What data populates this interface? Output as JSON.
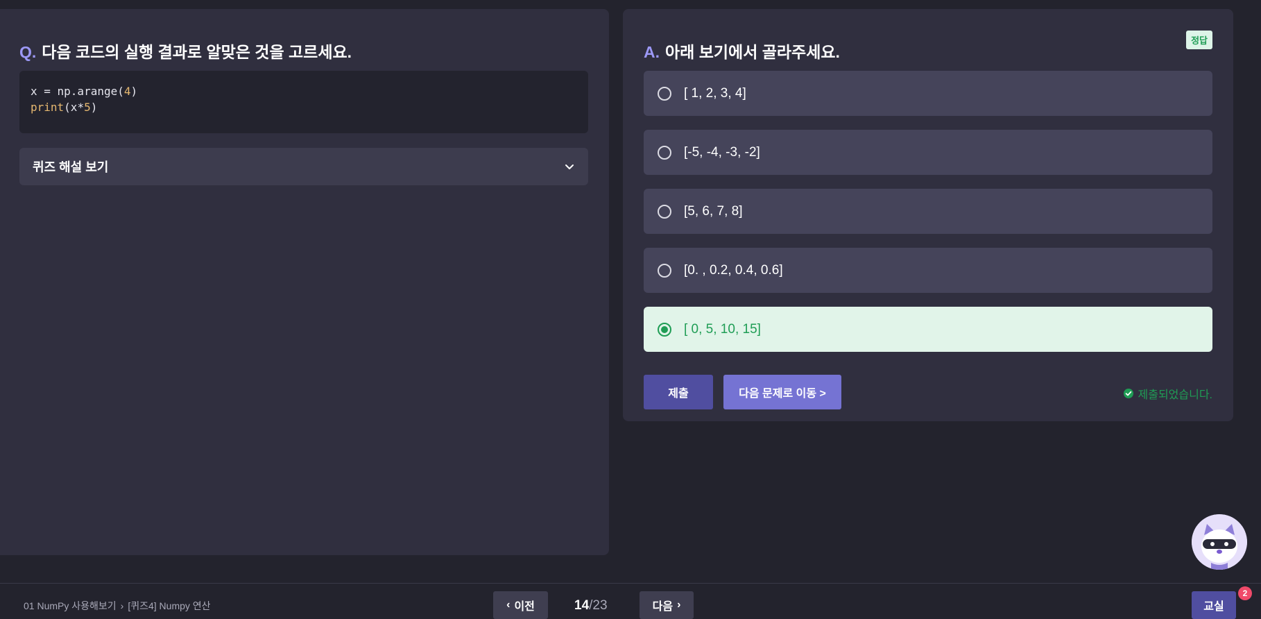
{
  "question": {
    "prefix": "Q.",
    "title": "다음 코드의 실행 결과로 알맞은 것을 고르세요.",
    "code": {
      "line1": "x = np.arange(",
      "line1_num": "4",
      "line1_end": ")",
      "line2_fn": "print",
      "line2_mid": "(x*",
      "line2_num": "5",
      "line2_end": ")"
    },
    "explain_label": "퀴즈 해설 보기"
  },
  "answer": {
    "prefix": "A.",
    "title": "아래 보기에서 골라주세요.",
    "badge": "정답",
    "options": [
      {
        "label": "[ 1, 2, 3, 4]",
        "selected": false
      },
      {
        "label": "[-5, -4, -3, -2]",
        "selected": false
      },
      {
        "label": "[5, 6, 7, 8]",
        "selected": false
      },
      {
        "label": "[0. , 0.2, 0.4, 0.6]",
        "selected": false
      },
      {
        "label": "[ 0, 5, 10, 15]",
        "selected": true
      }
    ],
    "submit_label": "제출",
    "next_question_label": "다음 문제로 이동 >",
    "submitted_text": "제출되었습니다."
  },
  "footer": {
    "breadcrumb": [
      "01 NumPy 사용해보기",
      "[퀴즈4] Numpy 연산"
    ],
    "prev_label": "이전",
    "next_label": "다음",
    "page_current": "14",
    "page_sep": "/",
    "page_total": "23",
    "classroom_label": "교실",
    "classroom_badge": "2"
  },
  "colors": {
    "accent": "#9c98f6",
    "success": "#1f9d55",
    "panel": "#302f3f",
    "background": "#23232d"
  }
}
